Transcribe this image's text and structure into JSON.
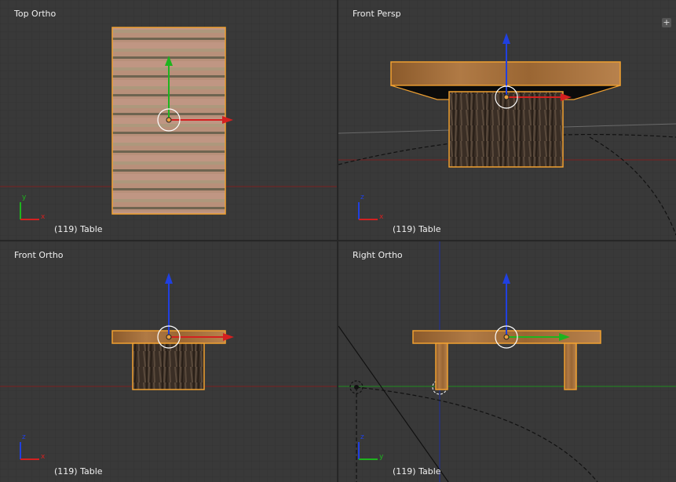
{
  "viewports": [
    {
      "label": "Top Ortho",
      "status": "(119) Table"
    },
    {
      "label": "Front Persp",
      "status": "(119) Table"
    },
    {
      "label": "Front Ortho",
      "status": "(119) Table"
    },
    {
      "label": "Right Ortho",
      "status": "(119) Table"
    }
  ],
  "axis_labels": {
    "top": [
      "y",
      "x"
    ],
    "front_persp": [
      "z",
      "x"
    ],
    "front_ortho": [
      "z",
      "x"
    ],
    "right_ortho": [
      "z",
      "y"
    ]
  },
  "colors": {
    "x_axis": "#d42020",
    "y_axis": "#1eb41e",
    "z_axis": "#2040e0",
    "selection": "#f0a030",
    "background": "#393939"
  },
  "icons": [
    "view-options-plus-icon"
  ]
}
